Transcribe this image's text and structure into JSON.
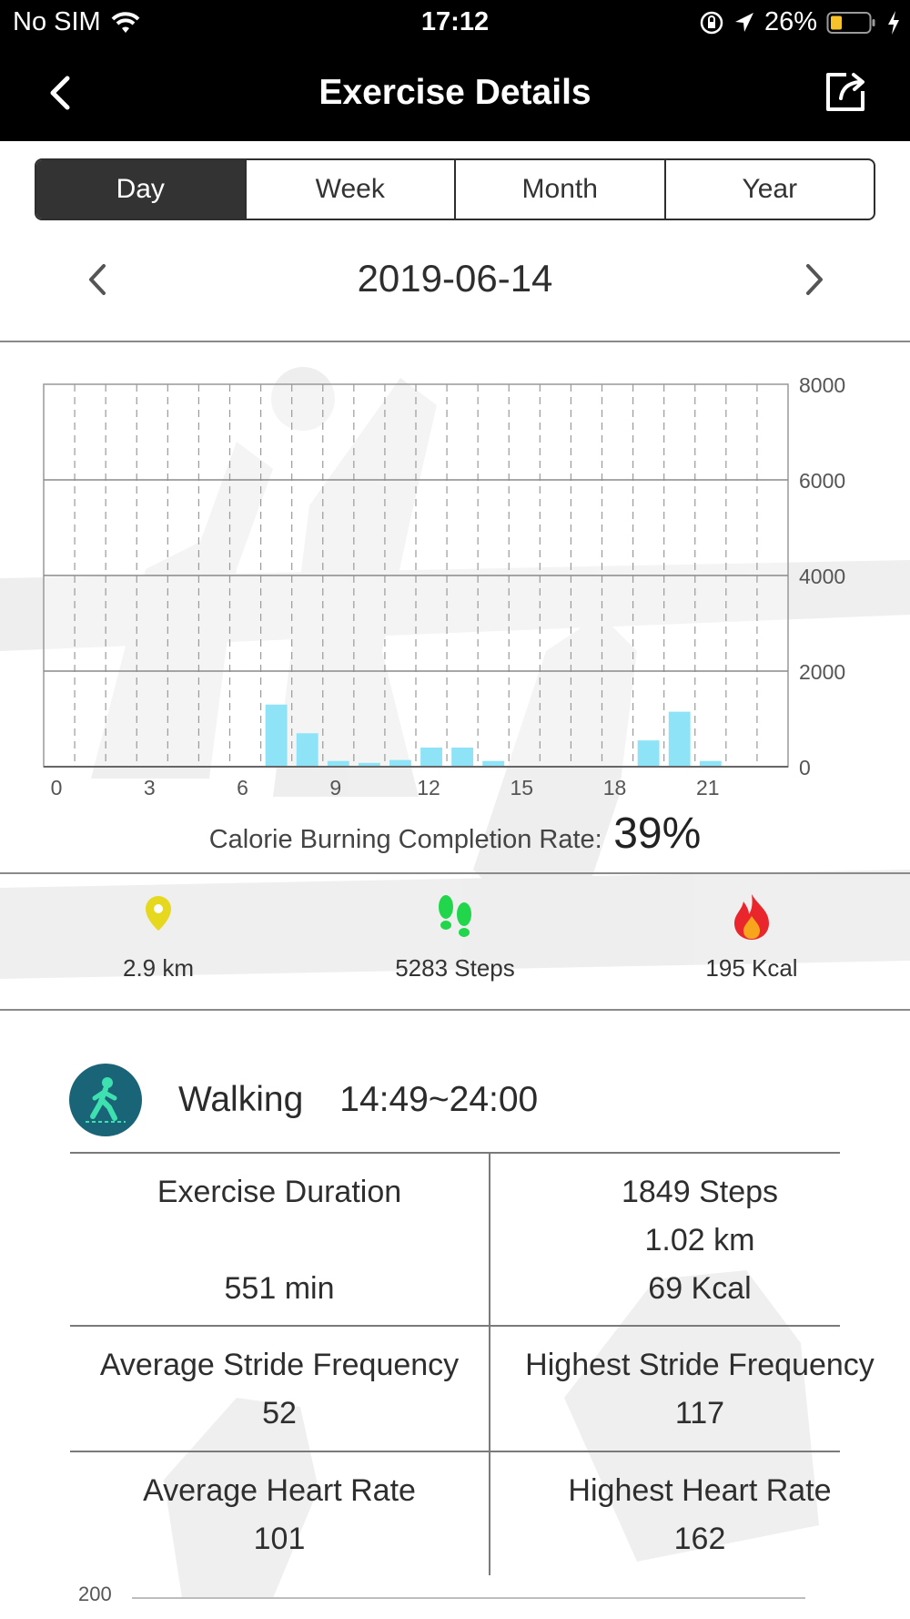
{
  "status_bar": {
    "carrier": "No SIM",
    "time": "17:12",
    "battery": "26%"
  },
  "header": {
    "title": "Exercise Details",
    "back_icon": "chevron-left-icon",
    "share_icon": "share-icon"
  },
  "tabs": [
    {
      "label": "Day",
      "active": true
    },
    {
      "label": "Week",
      "active": false
    },
    {
      "label": "Month",
      "active": false
    },
    {
      "label": "Year",
      "active": false
    }
  ],
  "date_nav": {
    "date": "2019-06-14"
  },
  "chart_data": {
    "type": "bar",
    "x": [
      0,
      1,
      2,
      3,
      4,
      5,
      6,
      7,
      8,
      9,
      10,
      11,
      12,
      13,
      14,
      15,
      16,
      17,
      18,
      19,
      20,
      21,
      22,
      23
    ],
    "values": [
      0,
      0,
      0,
      0,
      0,
      0,
      0,
      1300,
      700,
      120,
      80,
      140,
      400,
      400,
      120,
      0,
      0,
      0,
      0,
      550,
      1150,
      120,
      0,
      0
    ],
    "xticks": [
      "0",
      "3",
      "6",
      "9",
      "12",
      "15",
      "18",
      "21"
    ],
    "yticks": [
      "0",
      "2000",
      "4000",
      "6000",
      "8000"
    ],
    "ylim": [
      0,
      8000
    ],
    "bar_color": "#8fe3f7",
    "grid": true
  },
  "completion": {
    "label": "Calorie Burning Completion Rate:",
    "value": "39%"
  },
  "summary": [
    {
      "icon": "location-pin-icon",
      "text": "2.9 km",
      "color": "#e6d81e"
    },
    {
      "icon": "footprints-icon",
      "text": "5283 Steps",
      "color": "#22d64c"
    },
    {
      "icon": "flame-icon",
      "text": "195 Kcal",
      "color": "#e8262c"
    }
  ],
  "session": {
    "icon": "walking-icon",
    "name": "Walking",
    "range": "14:49~24:00",
    "duration_label": "Exercise Duration",
    "duration_value": "551 min",
    "steps": "1849 Steps",
    "distance": "1.02 km",
    "calories": "69 Kcal",
    "avg_stride_label": "Average Stride Frequency",
    "avg_stride_value": "52",
    "max_stride_label": "Highest Stride Frequency",
    "max_stride_value": "117",
    "avg_hr_label": "Average Heart Rate",
    "avg_hr_value": "101",
    "max_hr_label": "Highest Heart Rate",
    "max_hr_value": "162"
  },
  "hr_chart": {
    "top_tick": "200"
  }
}
